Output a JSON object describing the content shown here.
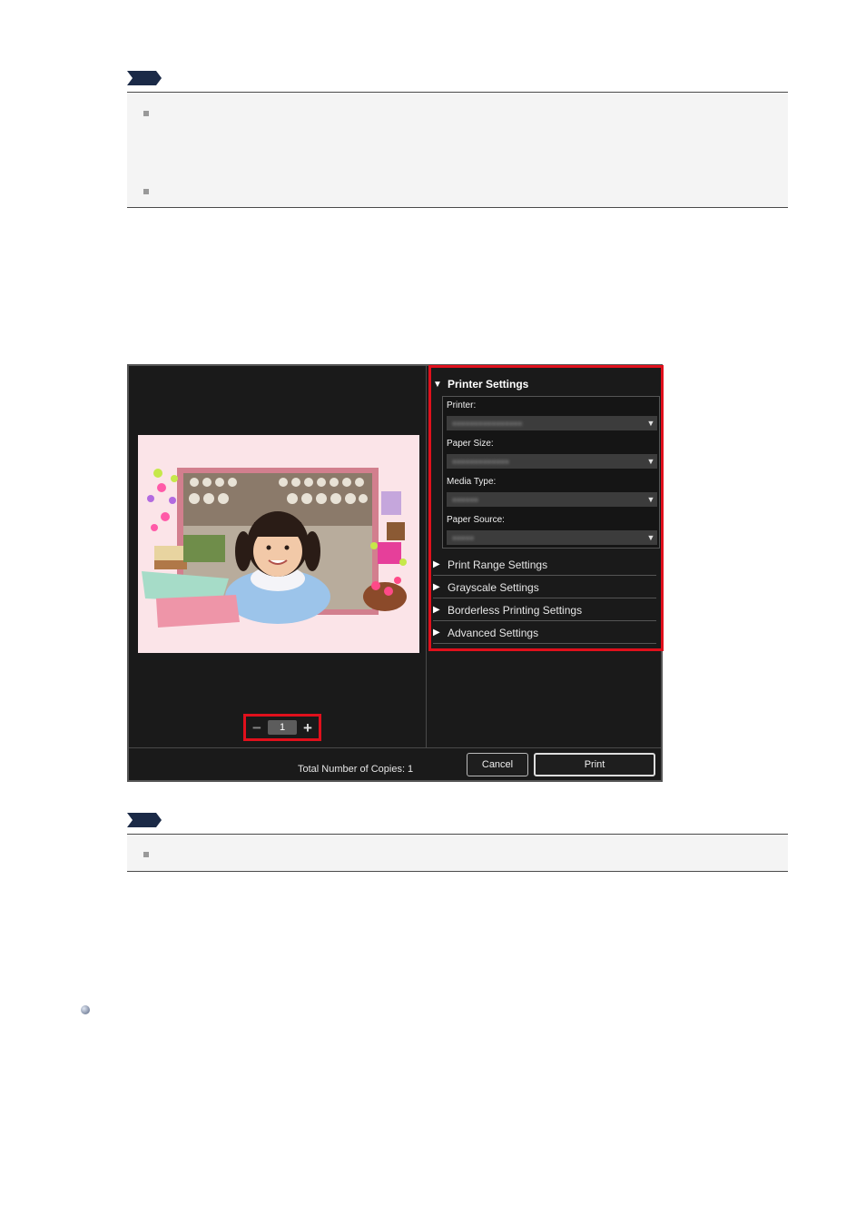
{
  "printer_settings_dialog": {
    "copies_control": {
      "minus_symbol": "−",
      "value": "1",
      "plus_symbol": "+"
    },
    "sections": {
      "printer_settings": "Printer Settings",
      "print_range_settings": "Print Range Settings",
      "grayscale_settings": "Grayscale Settings",
      "borderless_printing_settings": "Borderless Printing Settings",
      "advanced_settings": "Advanced Settings"
    },
    "fields": {
      "printer_label": "Printer:",
      "paper_size_label": "Paper Size:",
      "media_type_label": "Media Type:",
      "paper_source_label": "Paper Source:"
    },
    "footer": {
      "total_copies": "Total Number of Copies:  1",
      "cancel_label": "Cancel",
      "print_label": "Print"
    }
  },
  "colors": {
    "dialog_background": "#1a1a1a",
    "highlight_red": "#e0101c",
    "paper_pink": "#fbe4e8"
  },
  "icons": [
    "note-icon",
    "triangle-down-icon",
    "triangle-right-icon",
    "dropdown-arrow-icon",
    "bullet-sphere-icon"
  ]
}
